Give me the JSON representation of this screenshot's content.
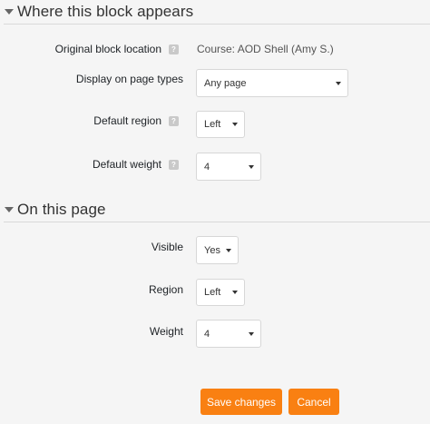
{
  "section1": {
    "title": "Where this block appears",
    "original_location_label": "Original block location",
    "original_location_value": "Course: AOD Shell (Amy S.)",
    "page_types_label": "Display on page types",
    "page_types_value": "Any page",
    "default_region_label": "Default region",
    "default_region_value": "Left",
    "default_weight_label": "Default weight",
    "default_weight_value": "4",
    "help_glyph": "?"
  },
  "section2": {
    "title": "On this page",
    "visible_label": "Visible",
    "visible_value": "Yes",
    "region_label": "Region",
    "region_value": "Left",
    "weight_label": "Weight",
    "weight_value": "4"
  },
  "buttons": {
    "save": "Save changes",
    "cancel": "Cancel"
  },
  "colors": {
    "accent": "#f98012",
    "background": "#f5f5f5"
  }
}
